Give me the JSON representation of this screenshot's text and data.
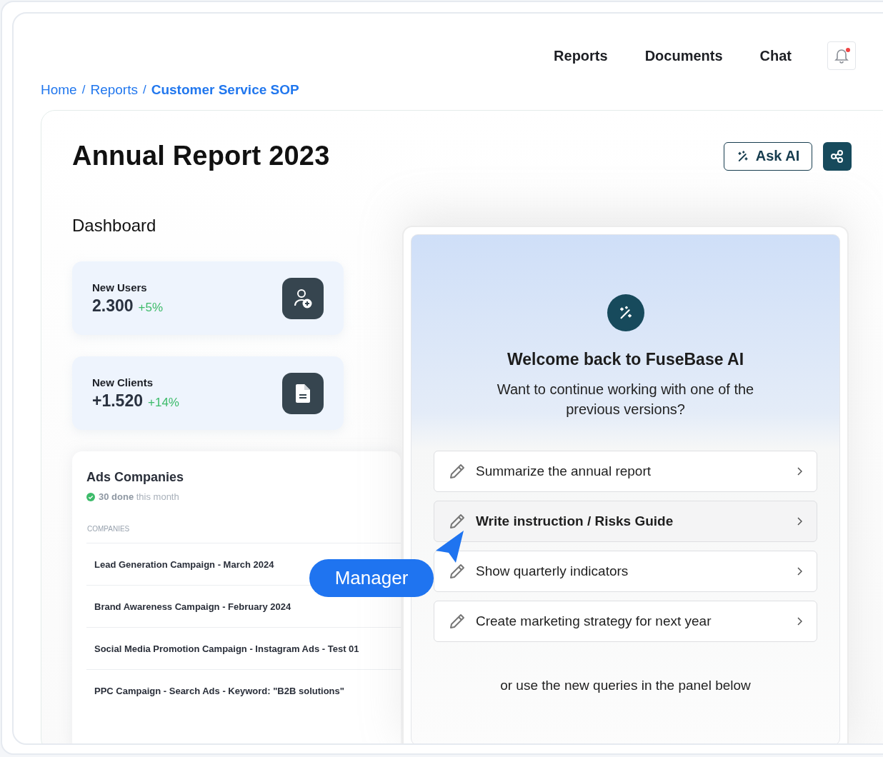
{
  "nav": {
    "items": [
      "Reports",
      "Documents",
      "Chat"
    ],
    "notifications": {
      "unread": true
    }
  },
  "breadcrumb": [
    {
      "label": "Home",
      "current": false
    },
    {
      "label": "Reports",
      "current": false
    },
    {
      "label": "Customer Service SOP",
      "current": true
    }
  ],
  "breadcrumb_separator": "/",
  "title": "Annual Report 2023",
  "ask_ai_button": "Ask AI",
  "dashboard": {
    "title": "Dashboard",
    "stats": [
      {
        "kind": "users",
        "label": "New Users",
        "value": "2.300",
        "change": "+5%"
      },
      {
        "kind": "document",
        "label": "New Clients",
        "value": "+1.520",
        "change": "+14%"
      }
    ]
  },
  "ads": {
    "title": "Ads Companies",
    "subtitle": "**30 done** this month",
    "column": "COMPANIES",
    "rows": [
      "Lead Generation Campaign - March 2024",
      "Brand Awareness Campaign - February 2024",
      "Social Media Promotion Campaign - Instagram Ads - Test 01",
      "PPC Campaign - Search Ads - Keyword: \"B2B solutions\""
    ]
  },
  "ai_panel": {
    "title": "Welcome back to FuseBase AI",
    "subtitle": "Want to continue working with one of the previous versions?",
    "options": [
      {
        "label": "Summarize the annual report",
        "selected": false
      },
      {
        "label": "Write instruction / Risks Guide",
        "selected": true
      },
      {
        "label": "Show quarterly indicators",
        "selected": false
      },
      {
        "label": "Create marketing strategy for next year",
        "selected": false
      }
    ],
    "footer": "or use the new queries in the panel below"
  },
  "cursor_badge": "Manager"
}
